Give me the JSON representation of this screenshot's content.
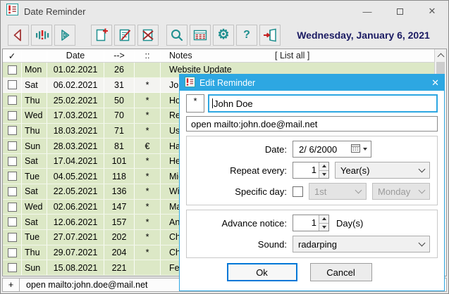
{
  "window": {
    "title": "Date Reminder",
    "controls": {
      "minimize": "—",
      "close": "✕"
    }
  },
  "toolbar": {
    "buttons": [
      {
        "name": "previous-button",
        "icon": "left-triangle-icon"
      },
      {
        "name": "today-button",
        "icon": "today-bars-icon"
      },
      {
        "name": "next-button",
        "icon": "right-triangle-icon"
      },
      {
        "name": "new-reminder-button",
        "icon": "page-plus-icon"
      },
      {
        "name": "edit-reminder-button",
        "icon": "page-pencil-icon"
      },
      {
        "name": "delete-reminder-button",
        "icon": "page-x-icon"
      },
      {
        "name": "search-button",
        "icon": "magnifier-icon"
      },
      {
        "name": "list-button",
        "icon": "table-icon"
      },
      {
        "name": "settings-button",
        "icon": "gear-icon"
      },
      {
        "name": "help-button",
        "icon": "question-icon"
      },
      {
        "name": "exit-button",
        "icon": "exit-door-icon"
      }
    ],
    "gear_glyph": "⚙",
    "help_glyph": "?",
    "date_display": "Wednesday, January 6, 2021"
  },
  "table": {
    "headers": {
      "check": "✓",
      "date": "Date",
      "days": "-->",
      "type": "::",
      "notes": "Notes",
      "list_all": "[ List all ]"
    },
    "rows": [
      {
        "day": "Mon",
        "date": "01.02.2021",
        "days": "26",
        "type": "",
        "notes": "Website Update",
        "selected": false
      },
      {
        "day": "Sat",
        "date": "06.02.2021",
        "days": "31",
        "type": "*",
        "notes": "John Doe",
        "selected": true
      },
      {
        "day": "Thu",
        "date": "25.02.2021",
        "days": "50",
        "type": "*",
        "notes": "Hosh",
        "selected": false
      },
      {
        "day": "Wed",
        "date": "17.03.2021",
        "days": "70",
        "type": "*",
        "notes": "Rena",
        "selected": false
      },
      {
        "day": "Thu",
        "date": "18.03.2021",
        "days": "71",
        "type": "*",
        "notes": "User",
        "selected": false
      },
      {
        "day": "Sun",
        "date": "28.03.2021",
        "days": "81",
        "type": "€",
        "notes": "Haftp",
        "selected": false
      },
      {
        "day": "Sat",
        "date": "17.04.2021",
        "days": "101",
        "type": "*",
        "notes": "Hein",
        "selected": false
      },
      {
        "day": "Tue",
        "date": "04.05.2021",
        "days": "118",
        "type": "*",
        "notes": "Mich",
        "selected": false
      },
      {
        "day": "Sat",
        "date": "22.05.2021",
        "days": "136",
        "type": "*",
        "notes": "Willi",
        "selected": false
      },
      {
        "day": "Wed",
        "date": "02.06.2021",
        "days": "147",
        "type": "*",
        "notes": "Mart",
        "selected": false
      },
      {
        "day": "Sat",
        "date": "12.06.2021",
        "days": "157",
        "type": "*",
        "notes": "Annil",
        "selected": false
      },
      {
        "day": "Tue",
        "date": "27.07.2021",
        "days": "202",
        "type": "*",
        "notes": "Chris",
        "selected": false
      },
      {
        "day": "Thu",
        "date": "29.07.2021",
        "days": "204",
        "type": "*",
        "notes": "Chris",
        "selected": false
      },
      {
        "day": "Sun",
        "date": "15.08.2021",
        "days": "221",
        "type": "",
        "notes": "Feier",
        "selected": false
      }
    ]
  },
  "statusbar": {
    "prefix": "+",
    "text": "open mailto:john.doe@mail.net"
  },
  "dialog": {
    "title": "Edit Reminder",
    "close_glyph": "✕",
    "flag_button": "*",
    "name_value": "John Doe",
    "action_value": "open mailto:john.doe@mail.net",
    "date": {
      "label": "Date:",
      "value": "2/ 6/2000"
    },
    "repeat": {
      "label": "Repeat every:",
      "value": "1",
      "unit": "Year(s)"
    },
    "specific_day": {
      "label": "Specific day:",
      "checked": false,
      "ordinal": "1st",
      "weekday": "Monday"
    },
    "advance": {
      "label": "Advance notice:",
      "value": "1",
      "unit": "Day(s)"
    },
    "sound": {
      "label": "Sound:",
      "value": "radarping"
    },
    "ok_label": "Ok",
    "cancel_label": "Cancel"
  },
  "colors": {
    "dialog_accent": "#2da7e2",
    "ok_border": "#0078d7",
    "table_green": "#dce8c6",
    "icon_teal": "#1f8f8f",
    "icon_red": "#d42222",
    "icon_maroon": "#a13636",
    "date_navy": "#1b1b63"
  }
}
